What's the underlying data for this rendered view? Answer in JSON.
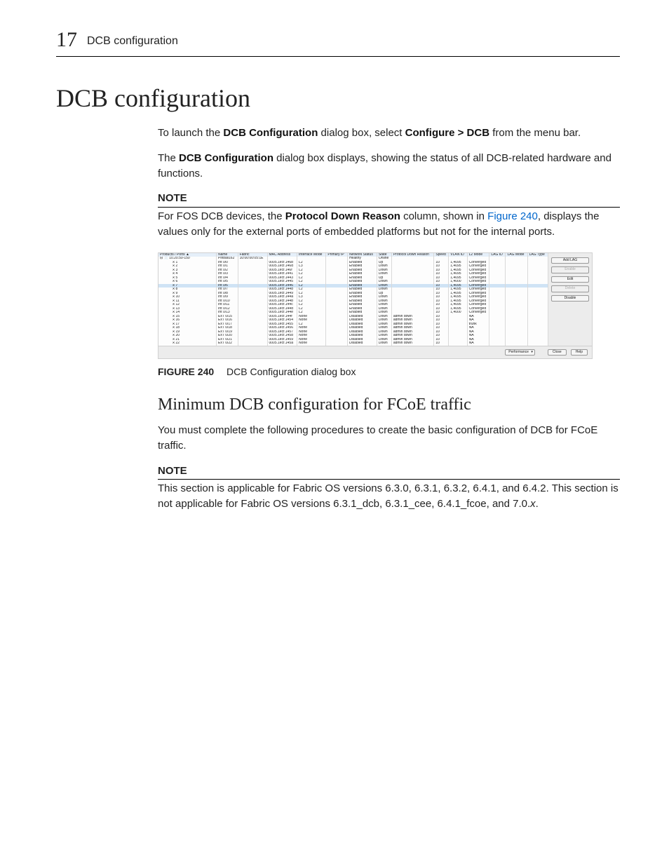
{
  "chapter": {
    "number": "17",
    "running_title": "DCB configuration"
  },
  "title": "DCB configuration",
  "intro": {
    "p1_prefix": "To launch the ",
    "p1_bold1": "DCB Configuration",
    "p1_mid1": " dialog box, select ",
    "p1_bold2": "Configure > DCB",
    "p1_suffix": " from the menu bar.",
    "p2_prefix": "The ",
    "p2_bold1": "DCB Configuration",
    "p2_suffix": " dialog box displays, showing the status of all DCB-related hardware and functions."
  },
  "note1": {
    "label": "NOTE",
    "prefix": "For FOS DCB devices, the ",
    "bold": "Protocol Down Reason",
    "mid": " column, shown in ",
    "xref": "Figure 240",
    "suffix": ", displays the values only for the external ports of embedded platforms but not for the internal ports."
  },
  "figure": {
    "columns": [
      "Products / Ports ▲",
      "Name",
      "Fabric",
      "MAC Address",
      "Interface Mode",
      "Primary IP",
      "Network Status",
      "State",
      "Protocol Down Reason",
      "Speed",
      "VLAN ID",
      "L2 Mode",
      "LAG ID",
      "LAG Mode",
      "LAG Type"
    ],
    "root_row": {
      "tree": "⊟ 📄 10.20.50-150",
      "name": "Pinball162",
      "fabric": "10:00:00:05:1E",
      "status": "Healthy",
      "state": "Online"
    },
    "rows": [
      {
        "tree": "🞫 1",
        "name": "Int  0/0",
        "mac": "0005.1ecf.146b",
        "mode": "L2",
        "status": "Enabled",
        "state": "Up",
        "reason": "",
        "speed": "10",
        "vlan": "1,4095",
        "l2": "Converged"
      },
      {
        "tree": "🞫 2",
        "name": "Int  0/1",
        "mac": "0005.1ecf.146d",
        "mode": "L3",
        "status": "Enabled",
        "state": "Down",
        "reason": "",
        "speed": "10",
        "vlan": "1,4095",
        "l2": "Converged"
      },
      {
        "tree": "🞫 3",
        "name": "Int  0/2",
        "mac": "0005.1ecf.146f",
        "mode": "L2",
        "status": "Enabled",
        "state": "Down",
        "reason": "",
        "speed": "10",
        "vlan": "1,4095",
        "l2": "Converged"
      },
      {
        "tree": "🞫 4",
        "name": "Int  0/3",
        "mac": "0005.1ecf.1441",
        "mode": "L2",
        "status": "Enabled",
        "state": "Down",
        "reason": "",
        "speed": "10",
        "vlan": "1,4095",
        "l2": "Converged"
      },
      {
        "tree": "🞫 5",
        "name": "Int  0/4",
        "mac": "0005.1ecf.1443",
        "mode": "L2",
        "status": "Enabled",
        "state": "Up",
        "reason": "",
        "speed": "10",
        "vlan": "1,4095",
        "l2": "Converged"
      },
      {
        "tree": "🞫 6",
        "name": "Int  0/5",
        "mac": "0005.1ecf.1445",
        "mode": "L2",
        "status": "Enabled",
        "state": "Down",
        "reason": "",
        "speed": "10",
        "vlan": "1,4000",
        "l2": "Converged"
      },
      {
        "tree": "🞫 7",
        "name": "Int  0/6",
        "mac": "0005.1ecf.1446",
        "mode": "L2",
        "status": "Enabled",
        "state": "Down",
        "reason": "",
        "speed": "10",
        "vlan": "1,4095",
        "l2": "Converged",
        "sel": true
      },
      {
        "tree": "🞫 8",
        "name": "Int  0/7",
        "mac": "0005.1ecf.1448",
        "mode": "L2",
        "status": "Enabled",
        "state": "Down",
        "reason": "",
        "speed": "10",
        "vlan": "1,4095",
        "l2": "Converged"
      },
      {
        "tree": "🞫 9",
        "name": "Int  0/8",
        "mac": "0005.1ecf.1449",
        "mode": "L2",
        "status": "Enabled",
        "state": "Up",
        "reason": "",
        "speed": "10",
        "vlan": "1,4095",
        "l2": "Converged"
      },
      {
        "tree": "🞫 10",
        "name": "Int  0/9",
        "mac": "0005.1ecf.144a",
        "mode": "L3",
        "status": "Enabled",
        "state": "Down",
        "reason": "",
        "speed": "10",
        "vlan": "1,4095",
        "l2": "Converged"
      },
      {
        "tree": "🞫 11",
        "name": "Int  0/10",
        "mac": "0005.1ecf.144b",
        "mode": "L2",
        "status": "Enabled",
        "state": "Down",
        "reason": "",
        "speed": "10",
        "vlan": "1,4095",
        "l2": "Converged"
      },
      {
        "tree": "🞫 12",
        "name": "Int  0/11",
        "mac": "0005.1ecf.144c",
        "mode": "L2",
        "status": "Enabled",
        "state": "Down",
        "reason": "",
        "speed": "10",
        "vlan": "1,4095",
        "l2": "Converged"
      },
      {
        "tree": "🞫 13",
        "name": "Int  0/12",
        "mac": "0005.1ecf.144d",
        "mode": "L2",
        "status": "Enabled",
        "state": "Down",
        "reason": "",
        "speed": "10",
        "vlan": "1,4095",
        "l2": "Converged"
      },
      {
        "tree": "🞫 14",
        "name": "Int  0/13",
        "mac": "0005.1ecf.144e",
        "mode": "L2",
        "status": "Enabled",
        "state": "Down",
        "reason": "",
        "speed": "10",
        "vlan": "1,4000",
        "l2": "Converged"
      },
      {
        "tree": "🞫 15",
        "name": "ExT 0/15",
        "mac": "0005.1ecf.144f",
        "mode": "None",
        "status": "Disabled",
        "state": "Down",
        "reason": "admin down",
        "speed": "10",
        "vlan": "",
        "l2": "NA"
      },
      {
        "tree": "🞫 16",
        "name": "ExT 0/16",
        "mac": "0005.1ecf.1454",
        "mode": "None",
        "status": "Disabled",
        "state": "Down",
        "reason": "admin down",
        "speed": "10",
        "vlan": "",
        "l2": "NA"
      },
      {
        "tree": "🞫 17",
        "name": "ExT 0/17",
        "mac": "0005.1ecf.1455",
        "mode": "L2",
        "status": "Disabled",
        "state": "Down",
        "reason": "admin down",
        "speed": "10",
        "vlan": "",
        "l2": "trunk"
      },
      {
        "tree": "🞫 18",
        "name": "ExT 0/18",
        "mac": "0005.1ecf.1456",
        "mode": "None",
        "status": "Disabled",
        "state": "Down",
        "reason": "admin down",
        "speed": "10",
        "vlan": "",
        "l2": "NA"
      },
      {
        "tree": "🞫 19",
        "name": "ExT 0/19",
        "mac": "0005.1ecf.1457",
        "mode": "None",
        "status": "Disabled",
        "state": "Down",
        "reason": "admin down",
        "speed": "10",
        "vlan": "",
        "l2": "NA"
      },
      {
        "tree": "🞫 20",
        "name": "ExT 0/20",
        "mac": "0005.1ecf.1458",
        "mode": "None",
        "status": "Disabled",
        "state": "Down",
        "reason": "admin down",
        "speed": "10",
        "vlan": "",
        "l2": "NA"
      },
      {
        "tree": "🞫 21",
        "name": "ExT 0/21",
        "mac": "0005.1ecf.1459",
        "mode": "None",
        "status": "Disabled",
        "state": "Down",
        "reason": "admin down",
        "speed": "10",
        "vlan": "",
        "l2": "NA"
      },
      {
        "tree": "🞫 22",
        "name": "ExT 0/22",
        "mac": "0005.1ecf.145a",
        "mode": "None",
        "status": "Disabled",
        "state": "Down",
        "reason": "admin down",
        "speed": "10",
        "vlan": "",
        "l2": "NA"
      }
    ],
    "side_buttons": [
      {
        "label": "Add LAG",
        "enabled": true
      },
      {
        "label": "Enable",
        "enabled": false
      },
      {
        "label": "Edit",
        "enabled": true
      },
      {
        "label": "Delete",
        "enabled": false
      },
      {
        "label": "Disable",
        "enabled": true
      }
    ],
    "footer": {
      "performance": "Performance",
      "close": "Close",
      "help": "Help"
    }
  },
  "figure_caption": {
    "lead": "FIGURE 240",
    "text": "DCB Configuration dialog box"
  },
  "subhead": "Minimum DCB configuration for FCoE traffic",
  "sub_p": "You must complete the following procedures to create the basic configuration of DCB for FCoE traffic.",
  "note2": {
    "label": "NOTE",
    "text_a": "This section is applicable for Fabric OS versions 6.3.0, 6.3.1, 6.3.2, 6.4.1, and 6.4.2. This section is not applicable for Fabric OS versions 6.3.1_dcb, 6.3.1_cee, 6.4.1_fcoe, and 7.0.",
    "text_ital": "x",
    "text_b": "."
  }
}
